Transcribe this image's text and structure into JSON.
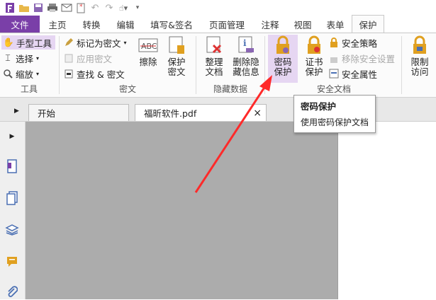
{
  "colors": {
    "accent": "#7a3fa8",
    "highlight": "#e6d6f2",
    "pdf_red": "#d33",
    "lock": "#e0a020",
    "arrow": "#ff2a2a"
  },
  "tabs": [
    "文件",
    "主页",
    "转换",
    "编辑",
    "填写&签名",
    "页面管理",
    "注释",
    "视图",
    "表单",
    "保护"
  ],
  "ribbon": {
    "tools": {
      "hand": "手型工具",
      "select": "选择",
      "zoom": "缩放",
      "group": "工具"
    },
    "redact": {
      "mark": "标记为密文",
      "apply": "应用密文",
      "find": "查找 & 密文",
      "erase": "擦除",
      "protect": "保护\n密文",
      "group": "密文"
    },
    "hidden": {
      "sort": "整理\n文档",
      "delete": "删除隐\n藏信息",
      "group": "隐藏数据"
    },
    "secure": {
      "password": "密码\n保护",
      "cert": "证书\n保护",
      "policy": "安全策略",
      "remove": "移除安全设置",
      "props": "安全属性",
      "group": "安全文档"
    },
    "restrict": {
      "access": "限制\n访问"
    }
  },
  "doc_tabs": {
    "start": "开始",
    "file": "福昕软件.pdf",
    "close": "×"
  },
  "tooltip": {
    "title": "密码保护",
    "desc": "使用密码保护文档"
  }
}
